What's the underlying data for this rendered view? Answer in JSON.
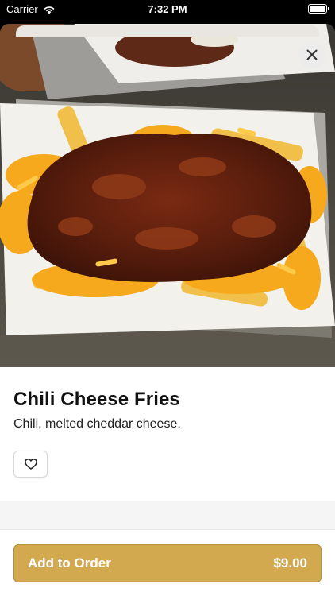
{
  "status_bar": {
    "carrier": "Carrier",
    "time": "7:32 PM"
  },
  "item": {
    "title": "Chili Cheese Fries",
    "description": "Chili, melted cheddar cheese."
  },
  "icons": {
    "close": "close-icon",
    "favorite": "heart-icon",
    "wifi": "wifi-icon",
    "battery": "battery-icon"
  },
  "footer": {
    "add_label": "Add to Order",
    "price": "$9.00"
  },
  "colors": {
    "accent": "#d2a94e",
    "accent_border": "#b78f36"
  }
}
